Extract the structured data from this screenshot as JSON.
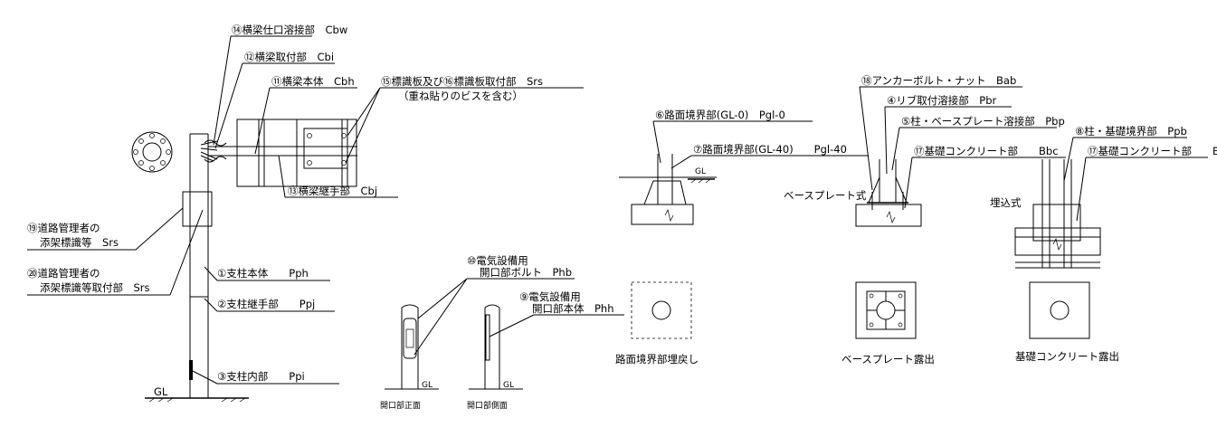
{
  "labels": {
    "l14": "⑭横梁仕口溶接部　Cbw",
    "l12": "⑫横梁取付部　Cbi",
    "l11": "⑪横梁本体　Cbh",
    "l15": "⑮標識板及び⑯標識板取付部　Srs",
    "l15b": "（重ね貼りのビスを含む）",
    "l13": "⑬横梁継手部　Cbj",
    "l19a": "⑲道路管理者の",
    "l19b": "添架標識等　Srs",
    "l20a": "⑳道路管理者の",
    "l20b": "添架標識等取付部　Srs",
    "l1": "①支柱本体　　Pph",
    "l2": "②支柱継手部　　Ppj",
    "l3": "③支柱内部　　Ppi",
    "gl": "GL",
    "l10a": "⑩電気設備用",
    "l10b": "開口部ボルト　Phb",
    "l9a": "⑨電気設備用",
    "l9b": "開口部本体　Phh",
    "open_front": "開口部正面",
    "open_side": "開口部側面",
    "l6": "⑥路面境界部(GL-0)　Pgl-0",
    "l7": "⑦路面境界部(GL-40)　　Pgl-40",
    "road_backfill": "路面境界部埋戻し",
    "l18": "⑱アンカーボルト・ナット　Bab",
    "l4": "④リブ取付溶接部　Pbr",
    "l5": "⑤柱・ベースプレート溶接部　Pbp",
    "l17": "⑰基礎コンクリート部　　Bbc",
    "baseplate_type": "ベースプレート式",
    "baseplate_exposed": "ベースプレート露出",
    "l8": "⑧柱・基礎境界部　Ppb",
    "embedded_type": "埋込式",
    "concrete_exposed": "基礎コンクリート露出"
  }
}
